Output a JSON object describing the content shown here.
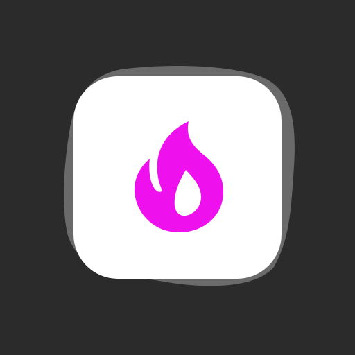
{
  "icon": {
    "name": "flame-icon",
    "color": "#ee11ee"
  },
  "tile": {
    "background": "#ffffff",
    "outline_color": "#6a6a6a"
  },
  "background_color": "#2b2b2b"
}
